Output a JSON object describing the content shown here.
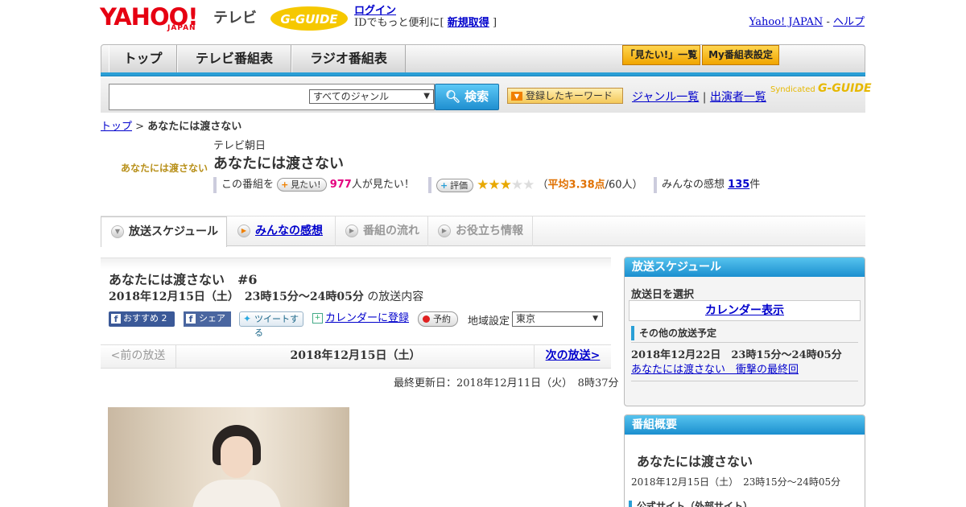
{
  "header": {
    "logo_yahoo": "YAHOO!",
    "logo_japan": "JAPAN",
    "logo_tv": "テレビ",
    "gguide": "G-GUIDE",
    "login": "ログイン",
    "login_note_pre": "IDでもっと便利に[",
    "signup": "新規取得",
    "login_note_post": "]",
    "yahoo_japan_link": "Yahoo! JAPAN",
    "sep": "-",
    "help_link": "ヘルプ"
  },
  "nav": {
    "tabs": [
      "トップ",
      "テレビ番組表",
      "ラジオ番組表"
    ],
    "want_list": "「見たい!」一覧",
    "my_schedule": "My番組表設定"
  },
  "search": {
    "input_value": "",
    "genre_selected": "すべてのジャンル",
    "search_button": "検索",
    "keyword_button": "登録したキーワード",
    "genre_list": "ジャンル一覧",
    "sep": "|",
    "cast_list": "出演者一覧",
    "syndicated": "Syndicated",
    "syndicated_logo": "G-GUIDE"
  },
  "breadcrumb": {
    "top": "トップ",
    "sep": ">",
    "current": "あなたには渡さない"
  },
  "program": {
    "thumb_text": "あなたには渡さない",
    "channel": "テレビ朝日",
    "title": "あなたには渡さない",
    "want_pre": "この番組を",
    "want_button": "見たい!",
    "want_count": "977",
    "want_post": "人が見たい！",
    "rating_button": "評価",
    "rating_value": 3.38,
    "rating_avg_label": "平均3.38点",
    "rating_count": "/60人）",
    "rating_open": "（",
    "comments_label": "みんなの感想",
    "comments_count": "135",
    "comments_unit": "件"
  },
  "tabs": {
    "schedule": "放送スケジュール",
    "comments": "みんなの感想",
    "flow": "番組の流れ",
    "info": "お役立ち情報"
  },
  "episode": {
    "title": "あなたには渡さない　#6",
    "date_time": "2018年12月15日（土）　23時15分～24時05分",
    "date_suffix": "の放送内容",
    "fb_recommend": "おすすめ 2",
    "fb_share": "シェア",
    "tweet": "ツイートする",
    "calendar_register": "カレンダーに登録",
    "reserve": "予約",
    "region_label": "地域設定",
    "region_selected": "東京",
    "prev": "<前の放送",
    "current_date": "2018年12月15日（土）",
    "next": "次の放送>",
    "updated": "最終更新日：2018年12月11日（火）　8時37分"
  },
  "sidebar": {
    "schedule_head": "放送スケジュール",
    "select_date": "放送日を選択",
    "calendar_button": "カレンダー表示",
    "other_head": "その他の放送予定",
    "other_date": "2018年12月22日　23時15分～24時05分",
    "other_link": "あなたには渡さない　衝撃の最終回",
    "summary_head": "番組概要",
    "summary_title": "あなたには渡さない",
    "summary_time": "2018年12月15日（土）　23時15分～24時05分",
    "official_site": "公式サイト（外部サイト）"
  }
}
